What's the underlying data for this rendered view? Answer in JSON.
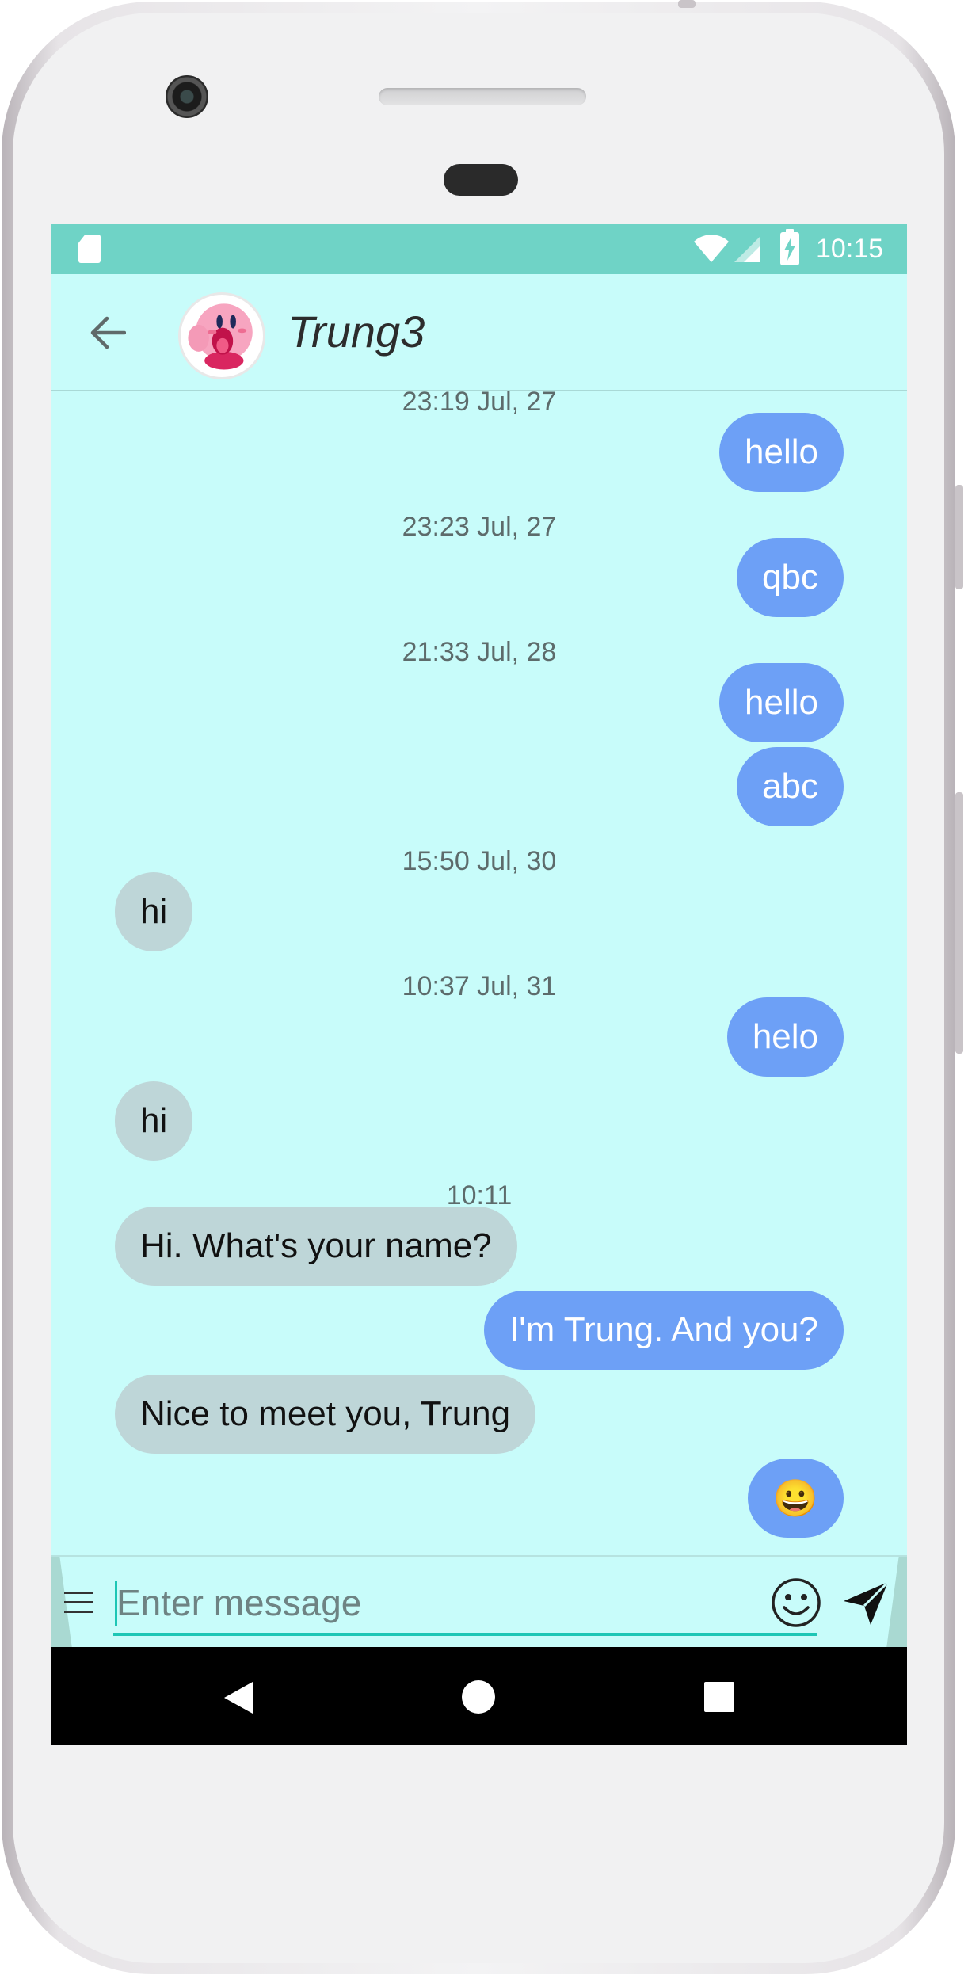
{
  "statusbar": {
    "time": "10:15"
  },
  "header": {
    "contact_name": "Trung3"
  },
  "messages": [
    {
      "kind": "time",
      "text": "23:19 Jul, 27"
    },
    {
      "kind": "out",
      "text": "hello"
    },
    {
      "kind": "time",
      "text": "23:23 Jul, 27"
    },
    {
      "kind": "out",
      "text": "qbc"
    },
    {
      "kind": "time",
      "text": "21:33 Jul, 28"
    },
    {
      "kind": "out",
      "text": "hello"
    },
    {
      "kind": "out",
      "text": "abc"
    },
    {
      "kind": "time",
      "text": "15:50 Jul, 30"
    },
    {
      "kind": "in",
      "text": "hi"
    },
    {
      "kind": "time",
      "text": "10:37 Jul, 31"
    },
    {
      "kind": "out",
      "text": "helo"
    },
    {
      "kind": "in",
      "text": "hi"
    },
    {
      "kind": "time",
      "text": "10:11"
    },
    {
      "kind": "in",
      "text": "Hi. What's your name?"
    },
    {
      "kind": "out",
      "text": "I'm Trung. And you?"
    },
    {
      "kind": "in",
      "text": "Nice to meet you, Trung"
    },
    {
      "kind": "out",
      "text": "😀"
    }
  ],
  "composer": {
    "placeholder": "Enter message",
    "value": ""
  },
  "colors": {
    "screen_bg": "#c8fcfa",
    "statusbar_bg": "#6fd3c6",
    "outgoing_bubble": "#6da0f6",
    "incoming_bubble": "#bed6d8",
    "input_underline": "#1dc6b5"
  },
  "icons": {
    "back": "arrow-left-icon",
    "menu": "hamburger-menu-icon",
    "emoji": "smiley-icon",
    "send": "send-icon"
  }
}
